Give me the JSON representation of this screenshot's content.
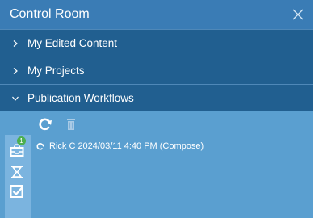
{
  "window": {
    "title": "Control Room"
  },
  "sections": [
    {
      "label": "My Edited Content",
      "expanded": false
    },
    {
      "label": "My Projects",
      "expanded": false
    },
    {
      "label": "Publication Workflows",
      "expanded": true
    }
  ],
  "toolbar": {
    "refresh_icon": "refresh-icon",
    "delete_icon": "trash-icon"
  },
  "sidebar": {
    "inbox_badge": "1",
    "buttons": [
      "inbox-icon",
      "hourglass-icon",
      "checkbox-icon"
    ]
  },
  "workflow_entry": {
    "text": "Rick C 2024/03/11 4:40 PM (Compose)"
  },
  "colors": {
    "panel": "#5a9fd0",
    "titlebar": "#3a7cb5",
    "section": "#215f90",
    "sidebar": "#7bb4df",
    "badge": "#4caf50"
  }
}
